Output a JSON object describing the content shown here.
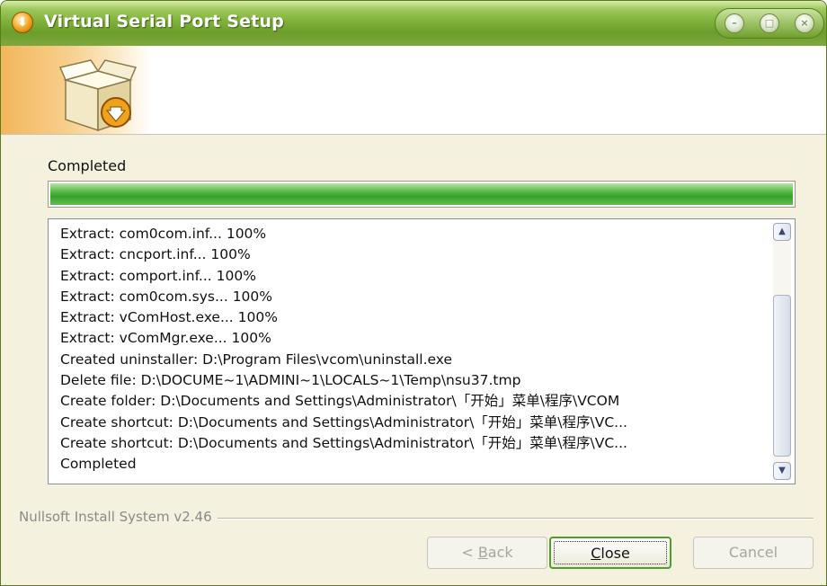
{
  "window": {
    "title": "Virtual Serial Port Setup",
    "controls": {
      "minimize_icon": "minimize-icon",
      "maximize_icon": "maximize-icon",
      "close_icon": "close-icon"
    }
  },
  "header": {
    "icon": "installer-box-icon"
  },
  "status": {
    "label": "Completed",
    "progress": 1.0
  },
  "log": {
    "lines": [
      "Extract: com0com.inf... 100%",
      "Extract: cncport.inf... 100%",
      "Extract: comport.inf... 100%",
      "Extract: com0com.sys... 100%",
      "Extract: vComHost.exe... 100%",
      "Extract: vComMgr.exe... 100%",
      "Created uninstaller: D:\\Program Files\\vcom\\uninstall.exe",
      "Delete file: D:\\DOCUME~1\\ADMINI~1\\LOCALS~1\\Temp\\nsu37.tmp",
      "Create folder: D:\\Documents and Settings\\Administrator\\「开始」菜单\\程序\\VCOM",
      "Create shortcut: D:\\Documents and Settings\\Administrator\\「开始」菜单\\程序\\VC...",
      "Create shortcut: D:\\Documents and Settings\\Administrator\\「开始」菜单\\程序\\VC...",
      "Completed"
    ]
  },
  "footer": {
    "branding": "Nullsoft Install System v2.46"
  },
  "buttons": {
    "back": {
      "prefix": "< ",
      "mnemonic": "B",
      "rest": "ack"
    },
    "close": {
      "mnemonic": "C",
      "rest": "lose"
    },
    "cancel": "Cancel"
  },
  "colors": {
    "titlebar": "#7fb23a",
    "progress": "#35a12a",
    "dialog_bg": "#f4f1de"
  }
}
